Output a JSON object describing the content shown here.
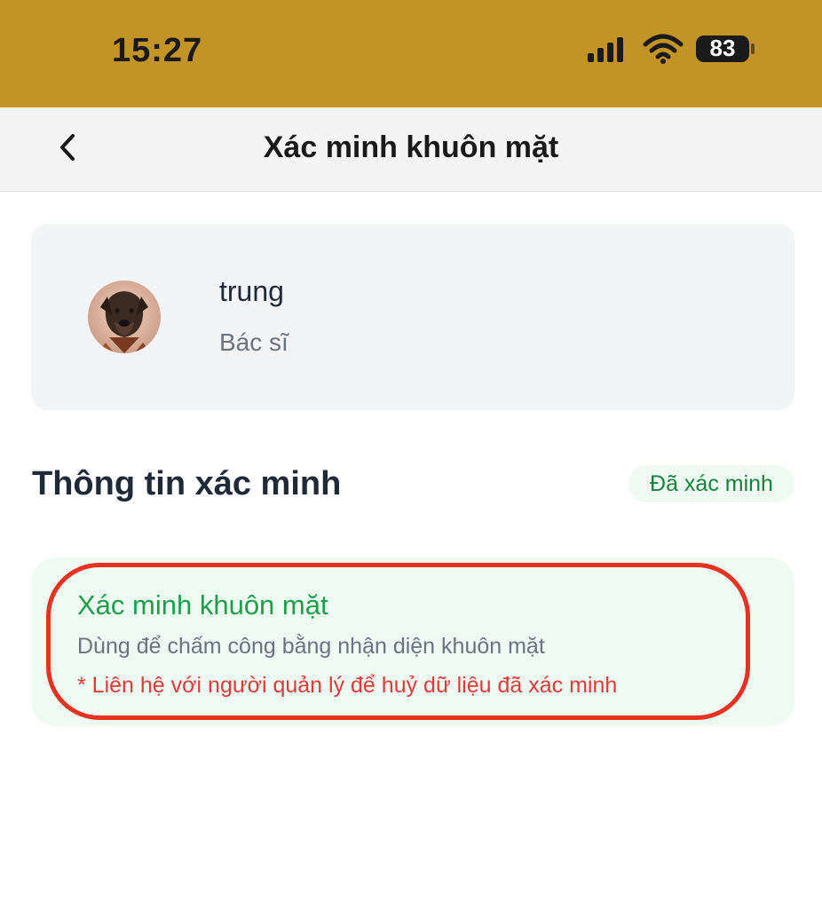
{
  "status_bar": {
    "time": "15:27",
    "battery": "83",
    "icons": [
      "signal-icon",
      "wifi-icon",
      "battery-icon"
    ]
  },
  "nav": {
    "title": "Xác minh khuôn mặt",
    "back_icon": "chevron-left-icon"
  },
  "profile": {
    "name": "trung",
    "role": "Bác sĩ",
    "avatar_icon": "dog-avatar"
  },
  "verification": {
    "section_title": "Thông tin xác minh",
    "status_badge": "Đã xác minh",
    "card": {
      "title": "Xác minh khuôn mặt",
      "description": "Dùng để chấm công bằng nhận diện khuôn mặt",
      "note": "* Liên hệ với người quản lý để huỷ dữ liệu đã xác minh"
    }
  },
  "colors": {
    "status_bar_bg": "#c29325",
    "success_green": "#1e9e4a",
    "badge_green": "#16803c",
    "warning_red": "#e03b3b",
    "highlight_red": "#e8311f"
  }
}
